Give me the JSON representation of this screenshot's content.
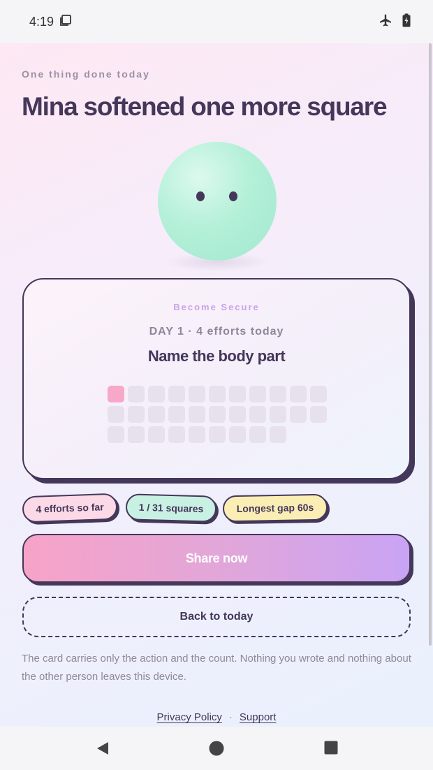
{
  "status_bar": {
    "time": "4:19"
  },
  "eyebrow": "One thing done today",
  "headline": "Mina softened one more square",
  "card": {
    "kicker": "Become Secure",
    "day_line": "DAY 1 · 4 efforts today",
    "task": "Name the body part",
    "squares_total": 31,
    "squares_done": 1
  },
  "chips": {
    "efforts": "4 efforts so far",
    "squares": "1 / 31 squares",
    "gap": "Longest gap 60s"
  },
  "buttons": {
    "share": "Share now",
    "back": "Back to today"
  },
  "note": "The card carries only the action and the count. Nothing you wrote and nothing about the other person leaves this device.",
  "footer": {
    "privacy": "Privacy Policy",
    "separator": "·",
    "support": "Support"
  },
  "colors": {
    "ink": "#44375a",
    "accent_pink": "#f7a7c8",
    "accent_lilac": "#c9a4f5",
    "mint": "#b4f0d8"
  },
  "icons": {
    "status_left": "screenshot-icon",
    "status_right": [
      "airplane-icon",
      "battery-charging-icon"
    ],
    "nav": [
      "back-icon",
      "home-icon",
      "recents-icon"
    ]
  }
}
